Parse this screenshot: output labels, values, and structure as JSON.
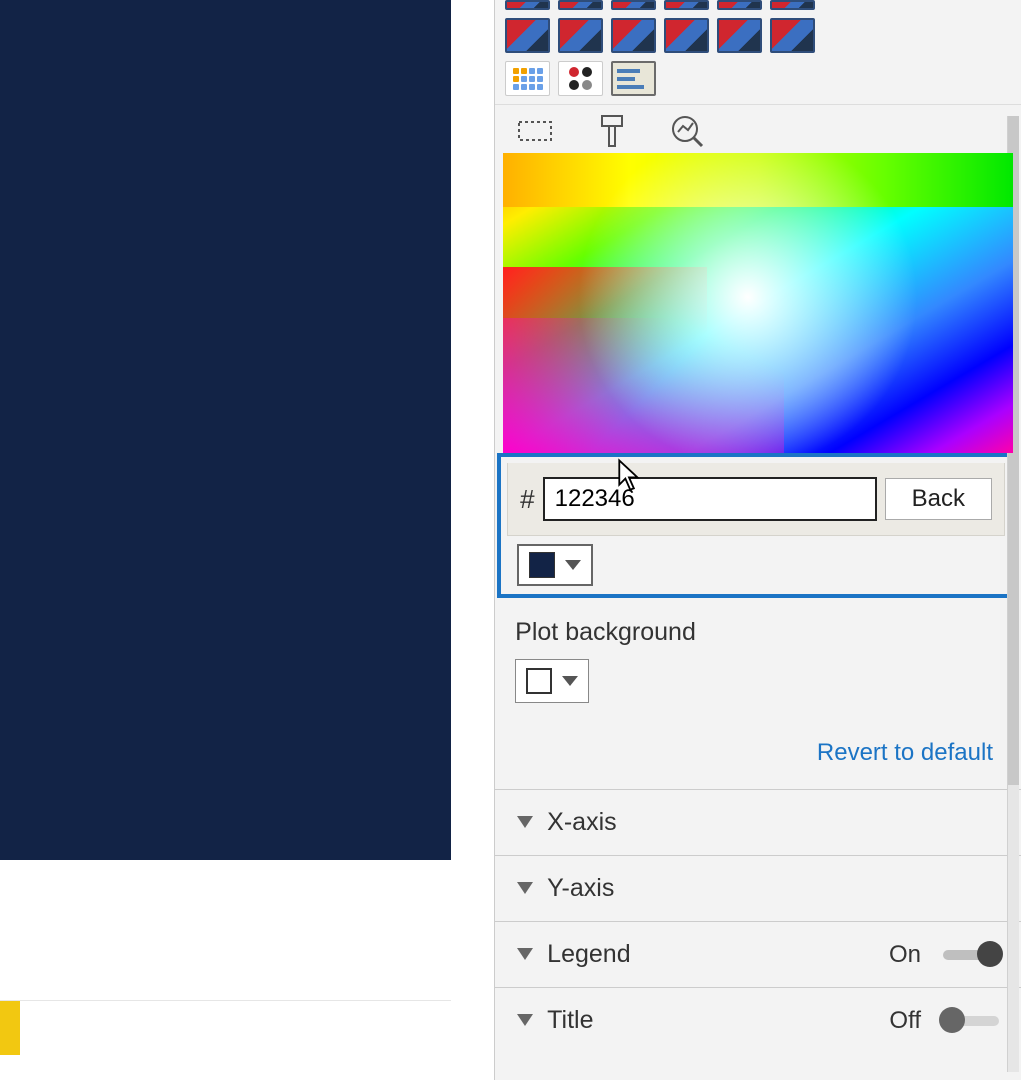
{
  "canvas": {
    "background_color": "#122346"
  },
  "color_picker": {
    "hash_symbol": "#",
    "hex_value": "122346",
    "back_button": "Back",
    "selected_swatch_color": "#122346"
  },
  "plot_background": {
    "label": "Plot background",
    "swatch_color": "#ffffff"
  },
  "revert_link": "Revert to default",
  "accordions": {
    "x_axis": {
      "label": "X-axis"
    },
    "y_axis": {
      "label": "Y-axis"
    },
    "legend": {
      "label": "Legend",
      "toggle_label": "On",
      "state": "on"
    },
    "title": {
      "label": "Title",
      "toggle_label": "Off",
      "state": "off"
    }
  }
}
